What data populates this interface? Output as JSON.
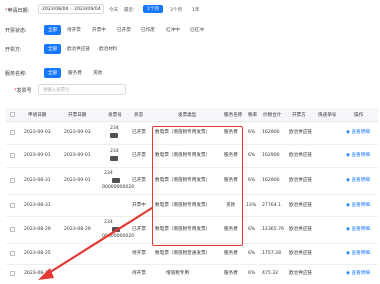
{
  "filters": {
    "apply_date": {
      "label": "申请日期:",
      "start": "2023/08/04",
      "end": "2023/09/04",
      "quick": [
        "今天",
        "最近:",
        "1个月",
        "3个月",
        "1年"
      ],
      "active_quick": "1个月"
    },
    "status": {
      "label": "开票状态:",
      "options": [
        "全部",
        "待开票",
        "开票中",
        "已开票",
        "已作废",
        "红冲中",
        "已红冲"
      ],
      "active": "全部"
    },
    "issuer": {
      "label": "开票方:",
      "options": [
        "全部",
        "欧冶供应链",
        "欧冶材料"
      ],
      "active": "全部"
    },
    "service": {
      "label": "服务名称:",
      "options": [
        "全部",
        "服务费",
        "货款"
      ],
      "active": "全部"
    },
    "invoice_no": {
      "label": "发票号",
      "placeholder": "请输入发票号"
    }
  },
  "table": {
    "headers": [
      "申请日期",
      "开票日期",
      "发票号",
      "状态",
      "发票类型",
      "服务名称",
      "税率",
      "价税合计",
      "开票方",
      "快递单号",
      "操作"
    ],
    "rows": [
      {
        "apply": "2023-09-03",
        "issue": "2023-09-03",
        "inv_top": "234",
        "inv_bottom": "",
        "status": "已开票",
        "type": "数电票（增值税专用发票）",
        "service": "服务费",
        "rate": "6%",
        "total": "162900",
        "issuer": "欧冶供应链",
        "express": "",
        "action": "查看明细"
      },
      {
        "apply": "2023-09-01",
        "issue": "2023-09-01",
        "inv_top": "234",
        "inv_bottom": "",
        "status": "已开票",
        "type": "数电票（增值税专用发票）",
        "service": "服务费",
        "rate": "6%",
        "total": "162900",
        "issuer": "欧冶供应链",
        "express": "",
        "action": "查看明细"
      },
      {
        "apply": "2023-08-31",
        "issue": "2023-09-01",
        "inv_top": "234",
        "inv_bottom": "00000000020",
        "status": "已开票",
        "type": "数电票（增值税专用发票）",
        "service": "服务费",
        "rate": "6%",
        "total": "162900",
        "issuer": "欧冶供应链",
        "express": "",
        "action": "查看明细"
      },
      {
        "apply": "2023-08-31",
        "issue": "",
        "inv_top": "",
        "inv_bottom": "",
        "status": "开票中",
        "type": "数电票（增值税专用发票）",
        "service": "货款",
        "rate": "13%",
        "total": "27764.1",
        "issuer": "欧冶供应链",
        "express": "",
        "action": "查看明细"
      },
      {
        "apply": "2023-08-29",
        "issue": "2023-08-29",
        "inv_top": "234",
        "inv_bottom": "00000000020",
        "status": "已开票",
        "type": "数电票（增值税专用发票）",
        "service": "服务费",
        "rate": "6%",
        "total": "12365.76",
        "issuer": "欧冶供应链",
        "express": "",
        "action": "查看明细"
      },
      {
        "apply": "2023-08-25",
        "issue": "",
        "inv_top": "",
        "inv_bottom": "",
        "status": "待开票",
        "type": "数电票（增值税普通发票）",
        "service": "服务费",
        "rate": "6%",
        "total": "1757.28",
        "issuer": "欧冶供应链",
        "express": "",
        "action": "查看明细"
      },
      {
        "apply": "2023-08-14",
        "issue": "",
        "inv_top": "",
        "inv_bottom": "",
        "status": "待开票",
        "type": "增值税专用",
        "service": "服务费",
        "rate": "6%",
        "total": "475.32",
        "issuer": "欧冶供应链",
        "express": "",
        "action": "查看明细"
      }
    ]
  },
  "colors": {
    "accent": "#1677ff",
    "highlight": "#e53935"
  }
}
